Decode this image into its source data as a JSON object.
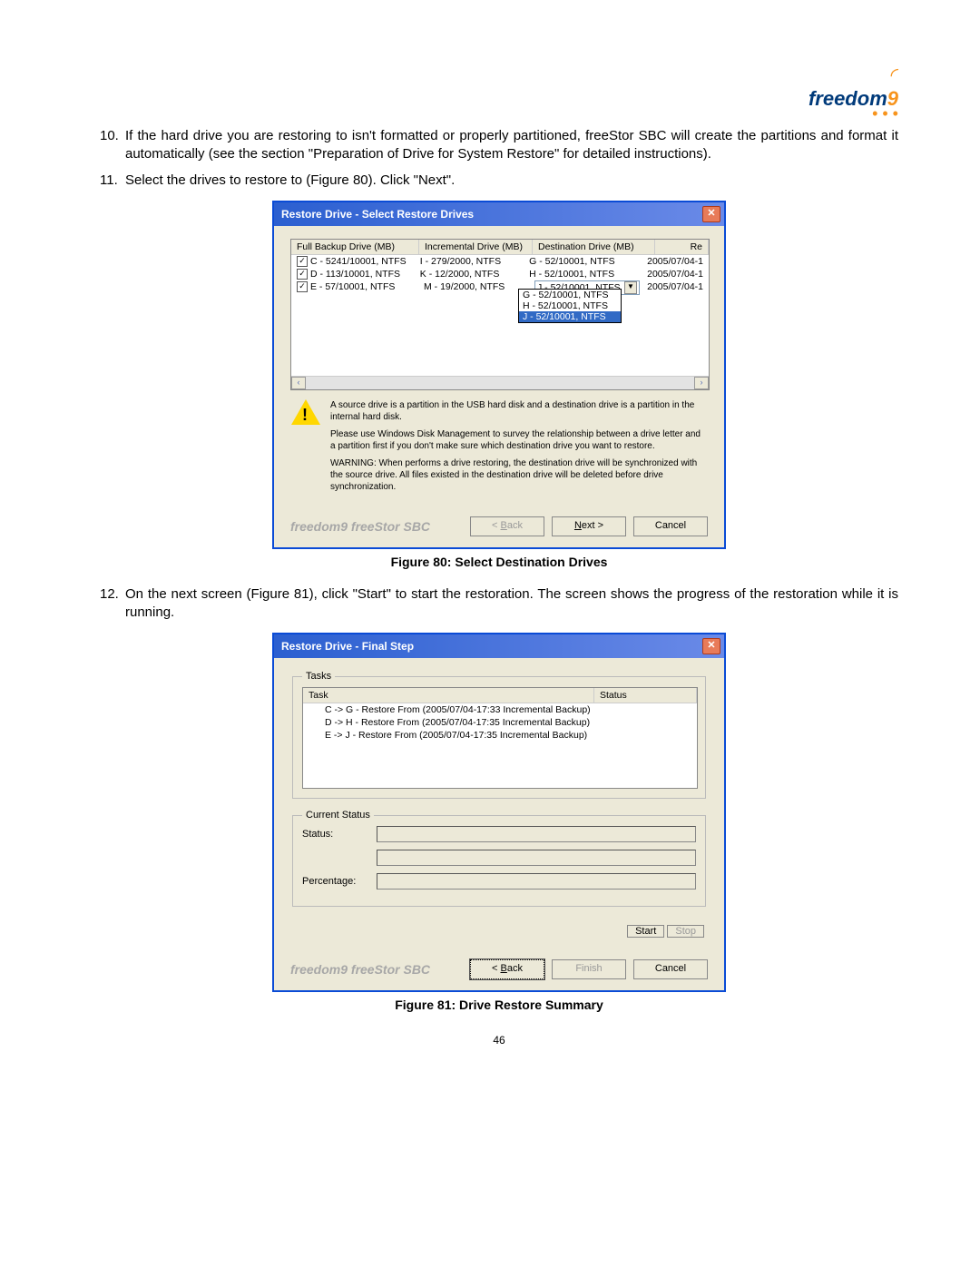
{
  "logo_text": "freedom",
  "logo_nine": "9",
  "steps": {
    "s10": {
      "num": "10.",
      "text": "If the hard drive you are restoring to isn't formatted or properly partitioned, freeStor SBC will create the partitions and format it automatically (see the section \"Preparation of Drive for System Restore\" for detailed instructions)."
    },
    "s11": {
      "num": "11.",
      "text": "Select the drives to restore to (Figure 80).  Click \"Next\"."
    },
    "s12": {
      "num": "12.",
      "text": "On the next screen (Figure 81), click \"Start\" to start the restoration.  The screen shows the progress of the restoration while it is running."
    }
  },
  "dialog1": {
    "title": "Restore Drive - Select Restore Drives",
    "headers": {
      "full": "Full Backup Drive (MB)",
      "inc": "Incremental Drive (MB)",
      "dest": "Destination Drive (MB)",
      "re": "Re"
    },
    "rows": [
      {
        "chk": "✓",
        "full": "C - 5241/10001, NTFS",
        "inc": "I - 279/2000, NTFS",
        "dest": "G - 52/10001, NTFS",
        "re": "2005/07/04-1"
      },
      {
        "chk": "✓",
        "full": "D - 113/10001, NTFS",
        "inc": "K - 12/2000, NTFS",
        "dest": "H - 52/10001, NTFS",
        "re": "2005/07/04-1"
      },
      {
        "chk": "✓",
        "full": "E - 57/10001, NTFS",
        "inc": "M - 19/2000, NTFS",
        "dest_dd": "J - 52/10001, NTFS",
        "re": "2005/07/04-1"
      }
    ],
    "dd_options": [
      "G - 52/10001, NTFS",
      "H - 52/10001, NTFS",
      "J - 52/10001, NTFS"
    ],
    "info1": "A source drive is a partition in the USB hard disk and a destination drive is a partition in the internal hard disk.",
    "info2": "Please use Windows Disk Management to survey the relationship between a drive letter and a partition first if you don't make sure which destination drive you want to restore.",
    "info3": "WARNING: When performs a drive restoring, the destination drive will be synchronized with the source drive.  All files existed in the destination drive will be deleted before drive synchronization.",
    "brand": "freedom9 freeStor SBC",
    "back": "< Back",
    "next": "Next >",
    "cancel": "Cancel"
  },
  "caption1": "Figure 80: Select Destination Drives",
  "dialog2": {
    "title": "Restore Drive - Final Step",
    "tasks_legend": "Tasks",
    "headers": {
      "task": "Task",
      "status": "Status"
    },
    "tasks": [
      "C -> G - Restore From (2005/07/04-17:33 Incremental Backup)",
      "D -> H - Restore From (2005/07/04-17:35 Incremental Backup)",
      "E -> J - Restore From (2005/07/04-17:35 Incremental Backup)"
    ],
    "cs_legend": "Current Status",
    "status_label": "Status:",
    "pct_label": "Percentage:",
    "start": "Start",
    "stop": "Stop",
    "brand": "freedom9 freeStor SBC",
    "back": "< Back",
    "finish": "Finish",
    "cancel": "Cancel"
  },
  "caption2": "Figure 81: Drive Restore Summary",
  "page_number": "46"
}
